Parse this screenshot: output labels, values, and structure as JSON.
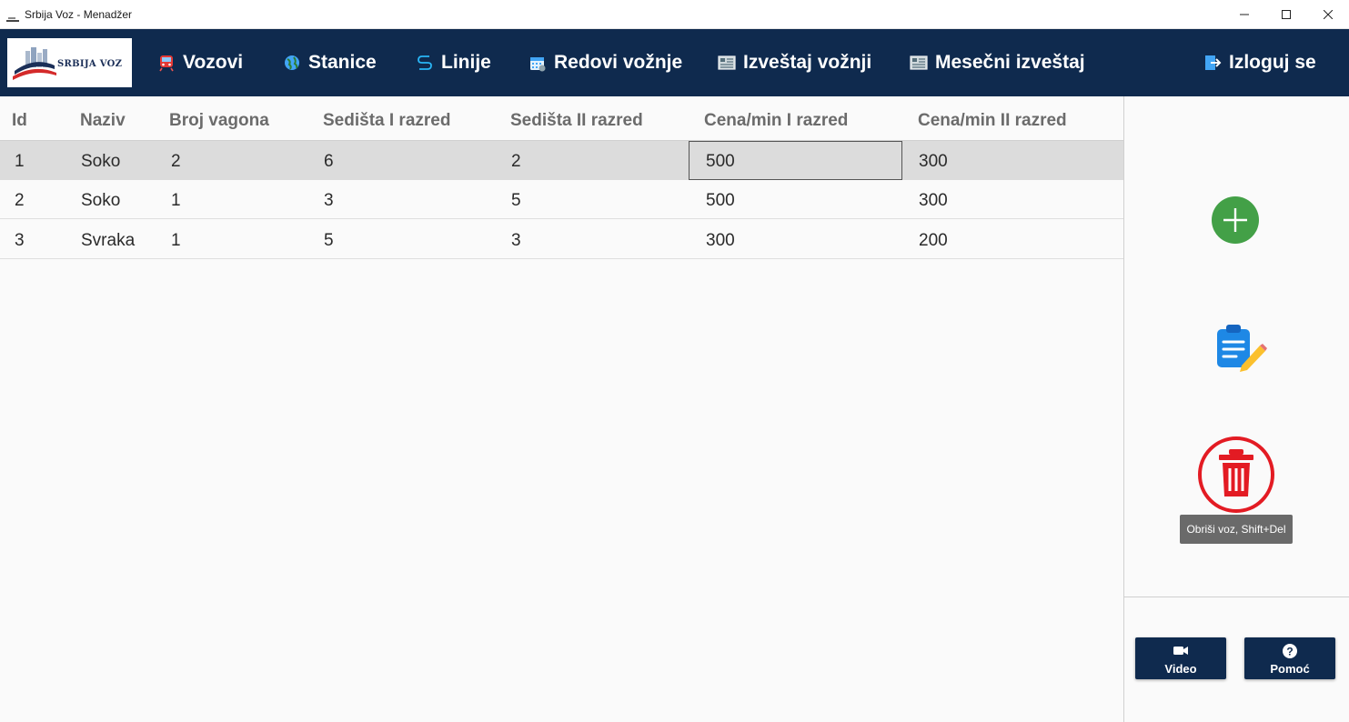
{
  "window": {
    "title": "Srbija Voz - Menadžer",
    "controls": [
      "minimize",
      "maximize",
      "close"
    ]
  },
  "logo": {
    "text": "SRBIJA VOZ"
  },
  "nav": {
    "items": [
      {
        "label": "Vozovi",
        "icon": "train-icon"
      },
      {
        "label": "Stanice",
        "icon": "globe-icon"
      },
      {
        "label": "Linije",
        "icon": "route-icon"
      },
      {
        "label": "Redovi vožnje",
        "icon": "calendar-icon"
      },
      {
        "label": "Izveštaj vožnji",
        "icon": "report-icon"
      },
      {
        "label": "Mesečni izveštaj",
        "icon": "report-icon"
      }
    ],
    "logout": {
      "label": "Izloguj se",
      "icon": "logout-icon"
    }
  },
  "table": {
    "columns": [
      "Id",
      "Naziv",
      "Broj vagona",
      "Sedišta I razred",
      "Sedišta II razred",
      "Cena/min I razred",
      "Cena/min II razred"
    ],
    "rows": [
      [
        "1",
        "Soko",
        "2",
        "6",
        "2",
        "500",
        "300"
      ],
      [
        "2",
        "Soko",
        "1",
        "3",
        "5",
        "500",
        "300"
      ],
      [
        "3",
        "Svraka",
        "1",
        "5",
        "3",
        "300",
        "200"
      ]
    ],
    "selected_row": 0
  },
  "actions": {
    "add": {
      "icon": "plus-circle-icon",
      "color": "#43a047"
    },
    "edit": {
      "icon": "clipboard-edit-icon",
      "color": "#1e88e5"
    },
    "delete": {
      "icon": "trash-icon",
      "color": "#e31b23"
    },
    "tooltip": "Obriši voz, Shift+Del"
  },
  "bottom_buttons": {
    "video": {
      "label": "Video",
      "icon": "video-camera-icon"
    },
    "help": {
      "label": "Pomoć",
      "icon": "help-icon"
    }
  },
  "colors": {
    "navbar": "#0f2a4e",
    "selected_row": "#dcdcdc",
    "header_text": "#6b6b6b"
  }
}
